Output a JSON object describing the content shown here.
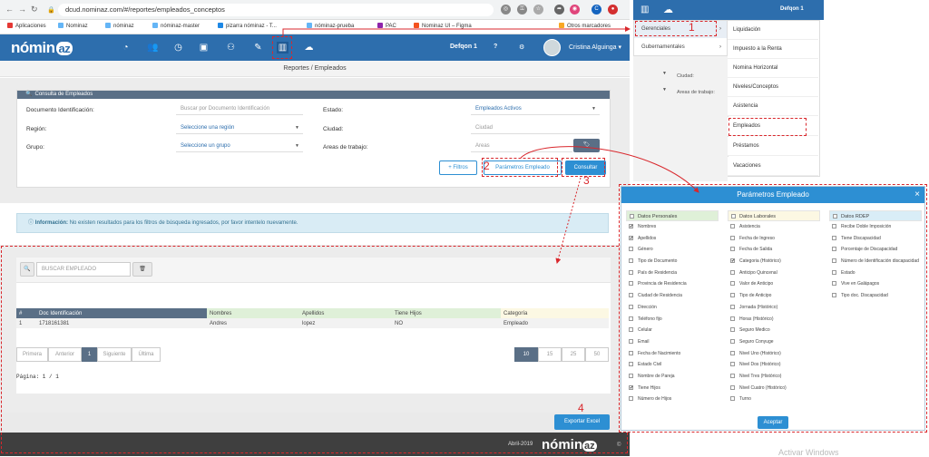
{
  "browser": {
    "url": "dcud.nominaz.com/#/reportes/empleados_conceptos",
    "bookmarks": [
      "Aplicaciones",
      "Nominaz",
      "nóminaz",
      "nóminaz-master",
      "pizarra nóminaz - T...",
      "nóminaz-prueba",
      "PAC",
      "Nominaz UI – Figma",
      "Otros marcadores"
    ]
  },
  "app": {
    "logo": "nómin",
    "logo_o": "az",
    "company": "Defqon 1",
    "help": "?",
    "user": "Cristina Alguinga ▾"
  },
  "breadcrumb": "Reportes / Empleados",
  "filters": {
    "title": "Consulta de Empleados",
    "doc_label": "Documento Identificación:",
    "doc_placeholder": "Buscar por Documento Identificación",
    "estado_label": "Estado:",
    "estado_value": "Empleados Activos",
    "region_label": "Región:",
    "region_value": "Seleccione una región",
    "ciudad_label": "Ciudad:",
    "ciudad_value": "Ciudad",
    "grupo_label": "Grupo:",
    "grupo_value": "Seleccione un grupo",
    "area_label": "Areas de trabajo:",
    "area_value": "Areas",
    "btn_filtros": "+ Filtros",
    "btn_parametros": "Parámetros Empleado",
    "btn_consultar": "Consultar"
  },
  "info": {
    "icon": "ⓘ",
    "bold": "Información:",
    "text": "No existen resultados para los filtros de búsqueda ingresados, por favor intentelo nuevamente."
  },
  "search": {
    "placeholder": "BUSCAR EMPLEADO"
  },
  "table": {
    "headers": [
      "#",
      "Doc Identificación",
      "Nombres",
      "Apellidos",
      "Tiene Hijos",
      "Categoría"
    ],
    "rows": [
      [
        "1",
        "1718161381",
        "Andres",
        "lopez",
        "NO",
        "Empleado"
      ]
    ]
  },
  "pagination": {
    "first": "Primera",
    "prev": "Anterior",
    "current": "1",
    "next": "Siguiente",
    "last": "Última",
    "sizes": [
      "10",
      "15",
      "25",
      "50"
    ],
    "summary": "Página: 1 / 1"
  },
  "export_button": "Exportar Excel",
  "footer": {
    "date": "Abril-2019",
    "logo": "nómin",
    "logo_o": "az",
    "copy": "©"
  },
  "reports_menu": {
    "company": "Defqon 1",
    "gerenciales": "Gerenciales",
    "gubernamentales": "Gubernamentales",
    "bg_labels": [
      "Ciudad:",
      "Areas de trabajo:"
    ],
    "items": [
      "Liquidación",
      "Impuesto a la Renta",
      "Nomina Horizontal",
      "Niveles/Conceptos",
      "Asistencia",
      "Empleados",
      "Préstamos",
      "Vacaciones"
    ]
  },
  "modal": {
    "title": "Parámetros Empleado",
    "close": "×",
    "accept": "Aceptar",
    "columns": [
      {
        "header": "Datos Personales",
        "color": "#dff0d8",
        "items": [
          [
            "Nombres",
            true
          ],
          [
            "Apellidos",
            true
          ],
          [
            "Género",
            false
          ],
          [
            "Tipo de Documento",
            false
          ],
          [
            "País de Residencia",
            false
          ],
          [
            "Provincia de Residencia",
            false
          ],
          [
            "Ciudad de Residencia",
            false
          ],
          [
            "Dirección",
            false
          ],
          [
            "Teléfono fijo",
            false
          ],
          [
            "Celular",
            false
          ],
          [
            "Email",
            false
          ],
          [
            "Fecha de Nacimiento",
            false
          ],
          [
            "Estado Civil",
            false
          ],
          [
            "Nombre de Pareja",
            false
          ],
          [
            "Tiene Hijos",
            true
          ],
          [
            "Número de Hijos",
            false
          ]
        ]
      },
      {
        "header": "Datos Laborales",
        "color": "#fcf8e3",
        "items": [
          [
            "Asistencia",
            false
          ],
          [
            "Fecha de Ingreso",
            false
          ],
          [
            "Fecha de Salida",
            false
          ],
          [
            "Categoria (Histórico)",
            true
          ],
          [
            "Anticipo Quincenal",
            false
          ],
          [
            "Valor de Anticipo",
            false
          ],
          [
            "Tipo de Anticipo",
            false
          ],
          [
            "Jornada (Histórico)",
            false
          ],
          [
            "Horas (Histórico)",
            false
          ],
          [
            "Seguro Medico",
            false
          ],
          [
            "Seguro Conyuge",
            false
          ],
          [
            "Nivel Uno (Histórico)",
            false
          ],
          [
            "Nivel Dos (Histórico)",
            false
          ],
          [
            "Nivel Tres (Histórico)",
            false
          ],
          [
            "Nivel Cuatro (Histórico)",
            false
          ],
          [
            "Turno",
            false
          ]
        ]
      },
      {
        "header": "Datos RDEP",
        "color": "#d9edf7",
        "items": [
          [
            "Recibe Doble Imposición",
            false
          ],
          [
            "Tiene Discapacidad",
            false
          ],
          [
            "Porcentaje de Discapacidad",
            false
          ],
          [
            "Número de Identificación discapacidad",
            false
          ],
          [
            "Estado",
            false
          ],
          [
            "Vive en Galápagos",
            false
          ],
          [
            "Tipo doc. Discapacidad",
            false
          ]
        ]
      }
    ]
  },
  "annotations": [
    "1",
    "2",
    "3",
    "4"
  ],
  "watermark": "Activar Windows",
  "colors": {
    "primary": "#2d6ead",
    "accent": "#2d8fd3",
    "annotation": "#d9272c"
  }
}
